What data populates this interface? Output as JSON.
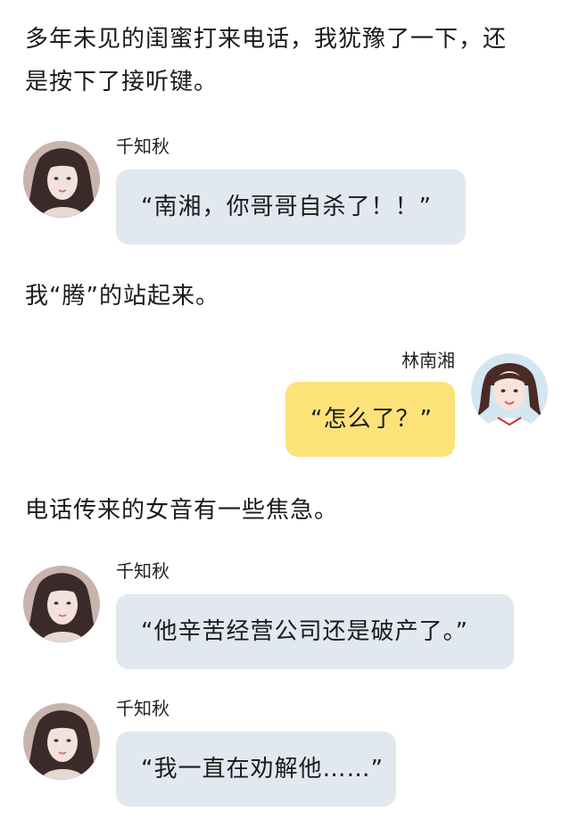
{
  "narration": [
    "多年未见的闺蜜打来电话，我犹豫了一下，还",
    "是按下了接听键。",
    "我“腾”的站起来。",
    "电话传来的女音有一些焦急。"
  ],
  "messages": [
    {
      "sender": "千知秋",
      "text": "“南湘，你哥哥自杀了！！”"
    },
    {
      "sender": "林南湘",
      "text": "“怎么了？”"
    },
    {
      "sender": "千知秋",
      "text": "“他辛苦经营公司还是破产了。”"
    },
    {
      "sender": "千知秋",
      "text": "“我一直在劝解他……”"
    }
  ],
  "colors": {
    "left_bubble": "#e1e8f0",
    "right_bubble": "#fde27a"
  }
}
